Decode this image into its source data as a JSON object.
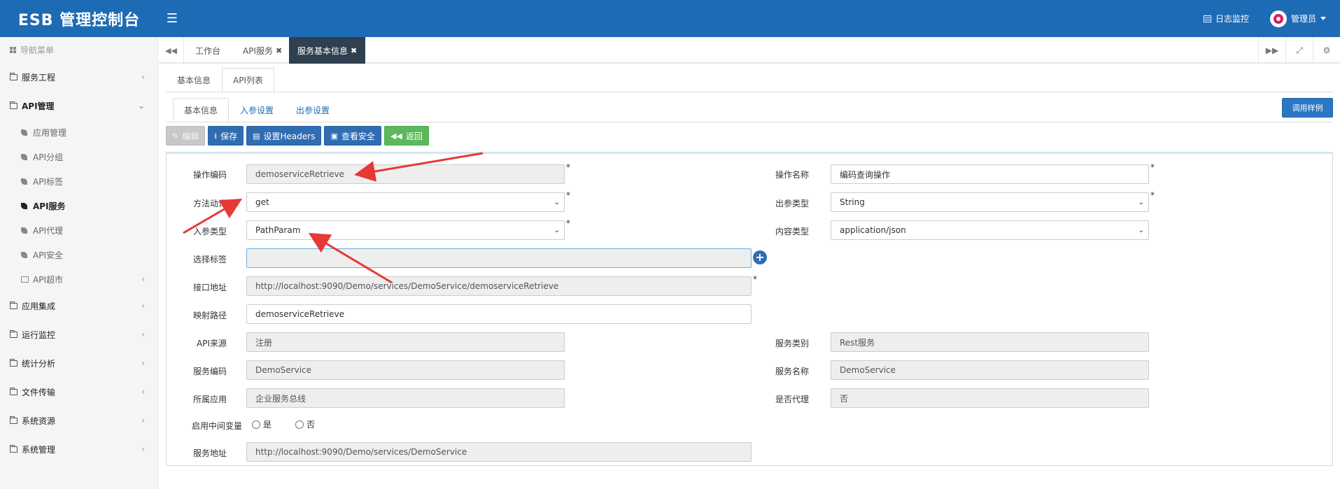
{
  "app": {
    "title": "ESB 管理控制台"
  },
  "topbar": {
    "log_monitor": "日志监控",
    "user": "管理员"
  },
  "sidebar": {
    "header": "导航菜单",
    "items": [
      {
        "label": "服务工程"
      },
      {
        "label": "API管理"
      },
      {
        "label": "应用集成"
      },
      {
        "label": "运行监控"
      },
      {
        "label": "统计分析"
      },
      {
        "label": "文件传输"
      },
      {
        "label": "系统资源"
      },
      {
        "label": "系统管理"
      }
    ],
    "api_sub": [
      {
        "label": "应用管理"
      },
      {
        "label": "API分组"
      },
      {
        "label": "API标签"
      },
      {
        "label": "API服务"
      },
      {
        "label": "API代理"
      },
      {
        "label": "API安全"
      },
      {
        "label": "API超市"
      }
    ]
  },
  "tabs": [
    {
      "label": "工作台"
    },
    {
      "label": "API服务"
    },
    {
      "label": "服务基本信息"
    }
  ],
  "subtabs": [
    {
      "label": "基本信息"
    },
    {
      "label": "API列表"
    }
  ],
  "innertabs": [
    {
      "label": "基本信息"
    },
    {
      "label": "入参设置"
    },
    {
      "label": "出参设置"
    }
  ],
  "sample_button": "调用样例",
  "toolbar": {
    "edit": "编辑",
    "save": "保存",
    "headers": "设置Headers",
    "security": "查看安全",
    "back": "返回"
  },
  "form": {
    "op_code": {
      "label": "操作编码",
      "value": "demoserviceRetrieve"
    },
    "op_name": {
      "label": "操作名称",
      "value": "编码查询操作"
    },
    "method": {
      "label": "方法动词",
      "value": "get"
    },
    "out_type": {
      "label": "出参类型",
      "value": "String"
    },
    "in_type": {
      "label": "入参类型",
      "value": "PathParam"
    },
    "content_type": {
      "label": "内容类型",
      "value": "application/json"
    },
    "tags": {
      "label": "选择标签",
      "value": ""
    },
    "endpoint": {
      "label": "接口地址",
      "value": "http://localhost:9090/Demo/services/DemoService/demoserviceRetrieve"
    },
    "mapping": {
      "label": "映射路径",
      "value": "demoserviceRetrieve"
    },
    "api_source": {
      "label": "API来源",
      "value": "注册"
    },
    "service_category": {
      "label": "服务类别",
      "value": "Rest服务"
    },
    "service_code": {
      "label": "服务编码",
      "value": "DemoService"
    },
    "service_name": {
      "label": "服务名称",
      "value": "DemoService"
    },
    "app": {
      "label": "所属应用",
      "value": "企业服务总线"
    },
    "is_proxy": {
      "label": "是否代理",
      "value": "否"
    },
    "middleware_var": {
      "label": "启用中间变量",
      "yes": "是",
      "no": "否"
    },
    "service_addr": {
      "label": "服务地址",
      "value": "http://localhost:9090/Demo/services/DemoService"
    },
    "required_mark": "*"
  }
}
